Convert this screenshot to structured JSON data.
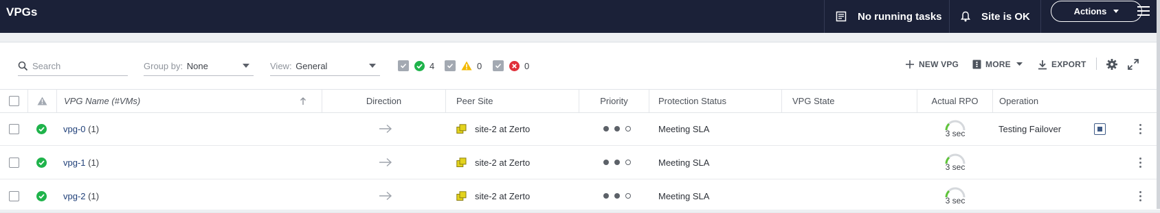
{
  "topbar": {
    "title": "VPGs",
    "tasks_label": "No running tasks",
    "site_status": "Site is OK",
    "actions_label": "Actions"
  },
  "toolbar": {
    "search_placeholder": "Search",
    "group_by_label": "Group by:",
    "group_by_value": "None",
    "view_label": "View:",
    "view_value": "General",
    "filters": [
      {
        "status": "ok",
        "count": "4"
      },
      {
        "status": "warning",
        "count": "0"
      },
      {
        "status": "error",
        "count": "0"
      }
    ],
    "new_vpg_label": "NEW VPG",
    "more_label": "MORE",
    "export_label": "EXPORT"
  },
  "table": {
    "columns": {
      "name": "VPG Name (#VMs)",
      "direction": "Direction",
      "peer_site": "Peer Site",
      "priority": "Priority",
      "protection_status": "Protection Status",
      "vpg_state": "VPG State",
      "actual_rpo": "Actual RPO",
      "operation": "Operation"
    },
    "rows": [
      {
        "name": "vpg-0",
        "vms": "(1)",
        "peer_site": "site-2 at Zerto",
        "priority": 2,
        "protection_status": "Meeting SLA",
        "vpg_state": "",
        "rpo": "3 sec",
        "operation": "Testing Failover"
      },
      {
        "name": "vpg-1",
        "vms": "(1)",
        "peer_site": "site-2 at Zerto",
        "priority": 2,
        "protection_status": "Meeting SLA",
        "vpg_state": "",
        "rpo": "3 sec",
        "operation": ""
      },
      {
        "name": "vpg-2",
        "vms": "(1)",
        "peer_site": "site-2 at Zerto",
        "priority": 2,
        "protection_status": "Meeting SLA",
        "vpg_state": "",
        "rpo": "3 sec",
        "operation": ""
      }
    ]
  },
  "colors": {
    "topbar_bg": "#1b2138",
    "ok_green": "#1fb34b",
    "warning_yellow": "#f3b900",
    "error_red": "#e0303a",
    "link_blue": "#1f3f78"
  }
}
